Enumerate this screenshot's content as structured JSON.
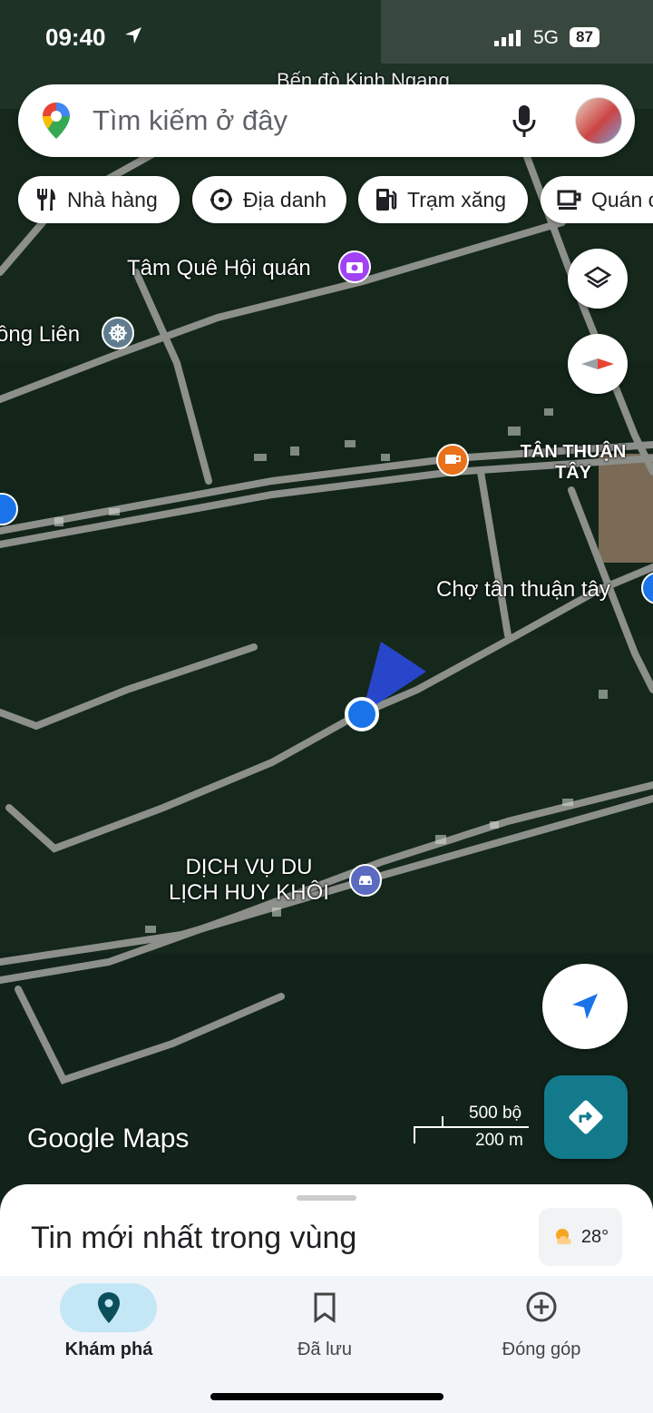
{
  "status_bar": {
    "time": "09:40",
    "network": "5G",
    "battery": "87"
  },
  "search": {
    "placeholder": "Tìm kiếm ở đây"
  },
  "chips": [
    {
      "label": "Nhà hàng",
      "icon": "fork-knife-icon"
    },
    {
      "label": "Địa danh",
      "icon": "landmark-icon"
    },
    {
      "label": "Trạm xăng",
      "icon": "gas-station-icon"
    },
    {
      "label": "Quán c",
      "icon": "coffee-cup-icon"
    }
  ],
  "map_labels": {
    "top_partial": "Bến đò Kinh Ngang",
    "tam_que": "Tâm Quê Hội quán",
    "dong_lien": "ồng Liên",
    "tan_thuan_line1": "TÂN THUẬN",
    "tan_thuan_line2": "TÂY",
    "cho": "Chợ tân thuận tây",
    "dich_vu_line1": "DỊCH VỤ DU",
    "dich_vu_line2": "LỊCH HUY KHÔI"
  },
  "branding": {
    "logo": "Google Maps"
  },
  "scale": {
    "top": "500 bộ",
    "bottom": "200 m"
  },
  "sheet": {
    "title": "Tin mới nhất trong vùng",
    "weather": "28°"
  },
  "nav": [
    {
      "label": "Khám phá",
      "icon": "location-pin-icon",
      "active": true
    },
    {
      "label": "Đã lưu",
      "icon": "bookmark-icon",
      "active": false
    },
    {
      "label": "Đóng góp",
      "icon": "add-circle-icon",
      "active": false
    }
  ],
  "colors": {
    "accent": "#137a8c",
    "location_dot": "#1a73e8",
    "active_pill": "#c3e7f5"
  }
}
